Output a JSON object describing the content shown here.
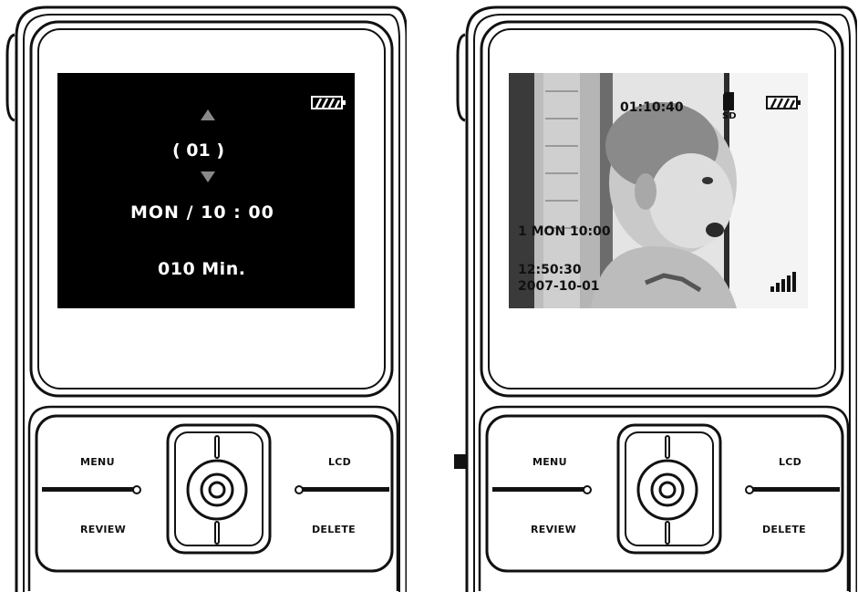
{
  "left_device": {
    "menu_label": "MENU",
    "review_label": "REVIEW",
    "lcd_label": "LCD",
    "delete_label": "DELETE",
    "screen": {
      "channel": "( 01 )",
      "schedule": "MON / 10 : 00",
      "duration": "010 Min."
    }
  },
  "right_device": {
    "menu_label": "MENU",
    "review_label": "REVIEW",
    "lcd_label": "LCD",
    "delete_label": "DELETE",
    "screen": {
      "rec_time": "01:10:40",
      "sd_label": "SD",
      "schedule": "1 MON 10:00",
      "clock": "12:50:30",
      "date": "2007-10-01"
    }
  },
  "arrow_icon": "right-arrow-icon",
  "icons": [
    "battery-icon",
    "up-arrow-icon",
    "down-arrow-icon",
    "sd-card-icon",
    "signal-strength-icon",
    "dpad-icon"
  ]
}
